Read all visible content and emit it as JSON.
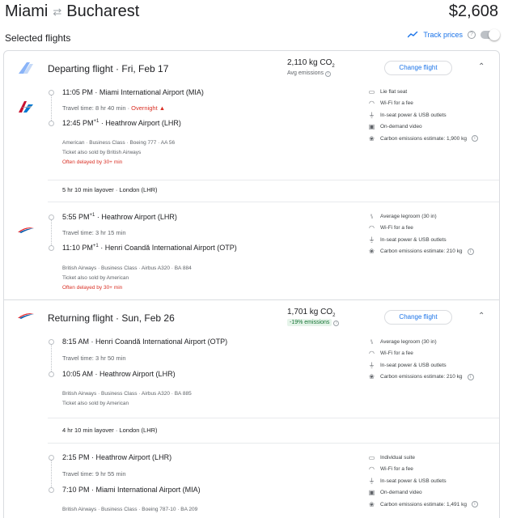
{
  "header": {
    "origin": "Miami",
    "destination": "Bucharest",
    "price": "$2,608"
  },
  "selected_label": "Selected flights",
  "track_prices": {
    "label": "Track prices",
    "help": "?"
  },
  "departing": {
    "title": "Departing flight · Fri, Feb 17",
    "co2": "2,110 kg CO",
    "co2_sub": "2",
    "emissions_label": "Avg emissions",
    "change_label": "Change flight",
    "legs": [
      {
        "dep_time": "11:05 PM",
        "dep_airport": "Miami International Airport (MIA)",
        "travel_time": "Travel time: 8 hr 40 min",
        "overnight": "Overnight",
        "arr_time": "12:45 PM",
        "arr_sup": "+1",
        "arr_airport": "Heathrow Airport (LHR)",
        "details": "American · Business Class · Boeing 777 · AA 56",
        "sold_by": "Ticket also sold by British Airways",
        "delay": "Often delayed by 30+ min",
        "amenities": [
          {
            "icon": "lie-flat-seat-icon",
            "label": "Lie flat seat"
          },
          {
            "icon": "wifi-icon",
            "label": "Wi-Fi for a fee"
          },
          {
            "icon": "power-icon",
            "label": "In-seat power & USB outlets"
          },
          {
            "icon": "video-icon",
            "label": "On-demand video"
          },
          {
            "icon": "co2-icon",
            "label": "Carbon emissions estimate: 1,900 kg"
          }
        ]
      },
      {
        "dep_time": "5:55 PM",
        "dep_sup": "+1",
        "dep_airport": "Heathrow Airport (LHR)",
        "travel_time": "Travel time: 3 hr 15 min",
        "arr_time": "11:10 PM",
        "arr_sup": "+1",
        "arr_airport": "Henri Coandă International Airport (OTP)",
        "details": "British Airways · Business Class · Airbus A320 · BA 884",
        "sold_by": "Ticket also sold by American",
        "delay": "Often delayed by 30+ min",
        "amenities": [
          {
            "icon": "legroom-icon",
            "label": "Average legroom (30 in)"
          },
          {
            "icon": "wifi-icon",
            "label": "Wi-Fi for a fee"
          },
          {
            "icon": "power-icon",
            "label": "In-seat power & USB outlets"
          },
          {
            "icon": "co2-icon",
            "label": "Carbon emissions estimate: 210 kg"
          }
        ]
      }
    ],
    "layover": "5 hr 10 min layover · London (LHR)"
  },
  "returning": {
    "title": "Returning flight · Sun, Feb 26",
    "co2": "1,701 kg CO",
    "co2_sub": "2",
    "emissions_label": "-19% emissions",
    "change_label": "Change flight",
    "legs": [
      {
        "dep_time": "8:15 AM",
        "dep_airport": "Henri Coandă International Airport (OTP)",
        "travel_time": "Travel time: 3 hr 50 min",
        "arr_time": "10:05 AM",
        "arr_airport": "Heathrow Airport (LHR)",
        "details": "British Airways · Business Class · Airbus A320 · BA 885",
        "sold_by": "Ticket also sold by American",
        "amenities": [
          {
            "icon": "legroom-icon",
            "label": "Average legroom (30 in)"
          },
          {
            "icon": "wifi-icon",
            "label": "Wi-Fi for a fee"
          },
          {
            "icon": "power-icon",
            "label": "In-seat power & USB outlets"
          },
          {
            "icon": "co2-icon",
            "label": "Carbon emissions estimate: 210 kg"
          }
        ]
      },
      {
        "dep_time": "2:15 PM",
        "dep_airport": "Heathrow Airport (LHR)",
        "travel_time": "Travel time: 9 hr 55 min",
        "arr_time": "7:10 PM",
        "arr_airport": "Miami International Airport (MIA)",
        "details": "British Airways · Business Class · Boeing 787-10 · BA 209",
        "amenities": [
          {
            "icon": "suite-icon",
            "label": "Individual suite"
          },
          {
            "icon": "wifi-icon",
            "label": "Wi-Fi for a fee"
          },
          {
            "icon": "power-icon",
            "label": "In-seat power & USB outlets"
          },
          {
            "icon": "video-icon",
            "label": "On-demand video"
          },
          {
            "icon": "co2-icon",
            "label": "Carbon emissions estimate: 1,491 kg"
          }
        ]
      }
    ],
    "layover": "4 hr 10 min layover · London (LHR)"
  },
  "colors": {
    "accent": "#1a73e8",
    "warning": "#d93025",
    "eco_green": "#137333",
    "aa_red": "#c8102e",
    "aa_blue": "#0078d2",
    "ba_red": "#eb2226",
    "ba_navy": "#075aaa"
  }
}
